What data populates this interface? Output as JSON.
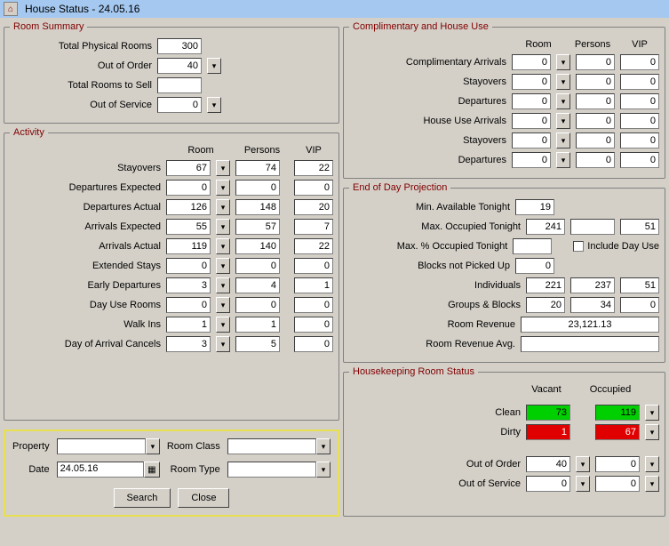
{
  "window": {
    "title": "House Status - 24.05.16"
  },
  "roomSummary": {
    "legend": "Room Summary",
    "totalPhysicalRooms": {
      "label": "Total Physical Rooms",
      "value": "300"
    },
    "outOfOrder": {
      "label": "Out of Order",
      "value": "40"
    },
    "totalRoomsToSell": {
      "label": "Total Rooms to Sell",
      "value": ""
    },
    "outOfService": {
      "label": "Out of Service",
      "value": "0"
    }
  },
  "activity": {
    "legend": "Activity",
    "headers": {
      "room": "Room",
      "persons": "Persons",
      "vip": "VIP"
    },
    "rows": [
      {
        "label": "Stayovers",
        "room": "67",
        "persons": "74",
        "vip": "22"
      },
      {
        "label": "Departures Expected",
        "room": "0",
        "persons": "0",
        "vip": "0"
      },
      {
        "label": "Departures Actual",
        "room": "126",
        "persons": "148",
        "vip": "20"
      },
      {
        "label": "Arrivals Expected",
        "room": "55",
        "persons": "57",
        "vip": "7"
      },
      {
        "label": "Arrivals Actual",
        "room": "119",
        "persons": "140",
        "vip": "22"
      },
      {
        "label": "Extended Stays",
        "room": "0",
        "persons": "0",
        "vip": "0"
      },
      {
        "label": "Early Departures",
        "room": "3",
        "persons": "4",
        "vip": "1"
      },
      {
        "label": "Day Use Rooms",
        "room": "0",
        "persons": "0",
        "vip": "0"
      },
      {
        "label": "Walk Ins",
        "room": "1",
        "persons": "1",
        "vip": "0"
      },
      {
        "label": "Day of Arrival Cancels",
        "room": "3",
        "persons": "5",
        "vip": "0"
      }
    ]
  },
  "filters": {
    "propertyLabel": "Property",
    "dateLabel": "Date",
    "dateValue": "24.05.16",
    "roomClassLabel": "Room Class",
    "roomTypeLabel": "Room Type",
    "searchLabel": "Search",
    "closeLabel": "Close"
  },
  "compHouse": {
    "legend": "Complimentary and House Use",
    "headers": {
      "room": "Room",
      "persons": "Persons",
      "vip": "VIP"
    },
    "rows": [
      {
        "label": "Complimentary Arrivals",
        "room": "0",
        "persons": "0",
        "vip": "0"
      },
      {
        "label": "Stayovers",
        "room": "0",
        "persons": "0",
        "vip": "0"
      },
      {
        "label": "Departures",
        "room": "0",
        "persons": "0",
        "vip": "0"
      },
      {
        "label": "House Use Arrivals",
        "room": "0",
        "persons": "0",
        "vip": "0"
      },
      {
        "label": "Stayovers",
        "room": "0",
        "persons": "0",
        "vip": "0"
      },
      {
        "label": "Departures",
        "room": "0",
        "persons": "0",
        "vip": "0"
      }
    ]
  },
  "eod": {
    "legend": "End of Day Projection",
    "minAvail": {
      "label": "Min. Available Tonight",
      "room": "19"
    },
    "maxOcc": {
      "label": "Max. Occupied Tonight",
      "room": "241",
      "persons": "",
      "vip": "51"
    },
    "maxPct": {
      "label": "Max. % Occupied Tonight",
      "room": ""
    },
    "includeDayUse": "Include Day Use",
    "blocksNotPicked": {
      "label": "Blocks not Picked Up",
      "room": "0"
    },
    "individuals": {
      "label": "Individuals",
      "room": "221",
      "persons": "237",
      "vip": "51"
    },
    "groupsBlocks": {
      "label": "Groups & Blocks",
      "room": "20",
      "persons": "34",
      "vip": "0"
    },
    "roomRevenue": {
      "label": "Room Revenue",
      "value": "23,121.13"
    },
    "roomRevenueAvg": {
      "label": "Room Revenue Avg.",
      "value": ""
    }
  },
  "hk": {
    "legend": "Housekeeping Room Status",
    "headers": {
      "vacant": "Vacant",
      "occupied": "Occupied"
    },
    "clean": {
      "label": "Clean",
      "vacant": "73",
      "occupied": "119"
    },
    "dirty": {
      "label": "Dirty",
      "vacant": "1",
      "occupied": "67"
    },
    "outOfOrder": {
      "label": "Out of Order",
      "vacant": "40",
      "occupied": "0"
    },
    "outOfService": {
      "label": "Out of Service",
      "vacant": "0",
      "occupied": "0"
    }
  }
}
